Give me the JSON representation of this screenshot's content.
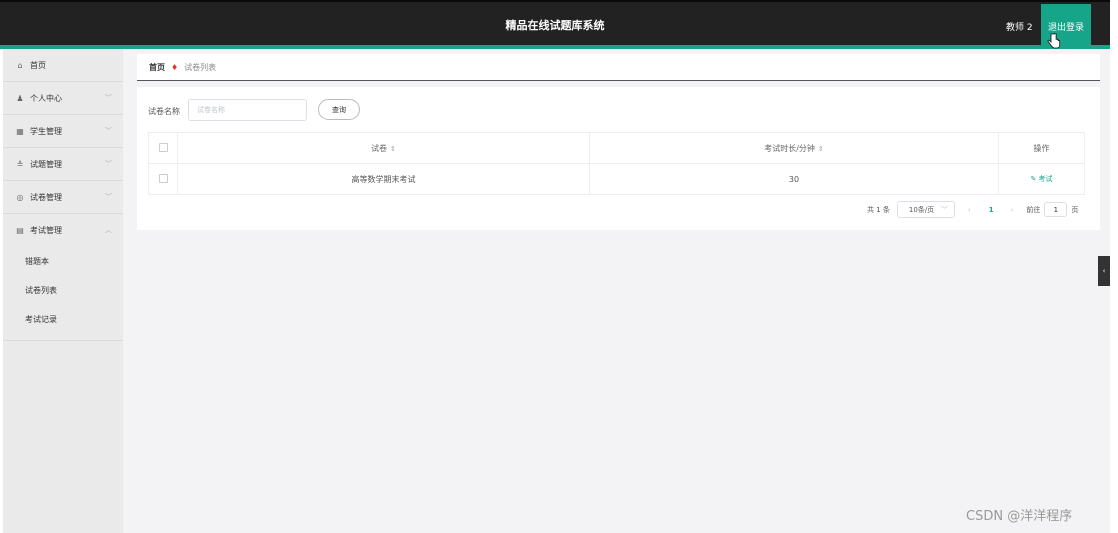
{
  "header": {
    "title": "精品在线试题库系统",
    "user_label": "教师 2",
    "logout_label": "退出登录"
  },
  "sidebar": {
    "items": [
      {
        "label": "首页",
        "icon": "home-icon"
      },
      {
        "label": "个人中心",
        "icon": "user-icon"
      },
      {
        "label": "学生管理",
        "icon": "grid-icon"
      },
      {
        "label": "试题管理",
        "icon": "bank-icon"
      },
      {
        "label": "试卷管理",
        "icon": "settings-icon"
      },
      {
        "label": "考试管理",
        "icon": "clipboard-icon"
      }
    ],
    "sub_items": [
      {
        "label": "错题本"
      },
      {
        "label": "试卷列表"
      },
      {
        "label": "考试记录"
      }
    ]
  },
  "breadcrumb": {
    "home": "首页",
    "current": "试卷列表"
  },
  "search": {
    "label": "试卷名称",
    "placeholder": "试卷名称",
    "button": "查询"
  },
  "table": {
    "headers": {
      "paper": "试卷",
      "duration": "考试时长/分钟",
      "actions": "操作"
    },
    "rows": [
      {
        "paper": "高等数学期末考试",
        "duration": "30",
        "action": "考试"
      }
    ]
  },
  "pagination": {
    "total": "共 1 条",
    "page_size": "10条/页",
    "current_page": "1",
    "goto_label": "前往",
    "goto_value": "1",
    "page_suffix": "页"
  },
  "watermark": "CSDN @洋洋程序",
  "colors": {
    "accent": "#17a58a",
    "topbar": "#222222",
    "breadcrumb_separator": "#e0392b"
  }
}
